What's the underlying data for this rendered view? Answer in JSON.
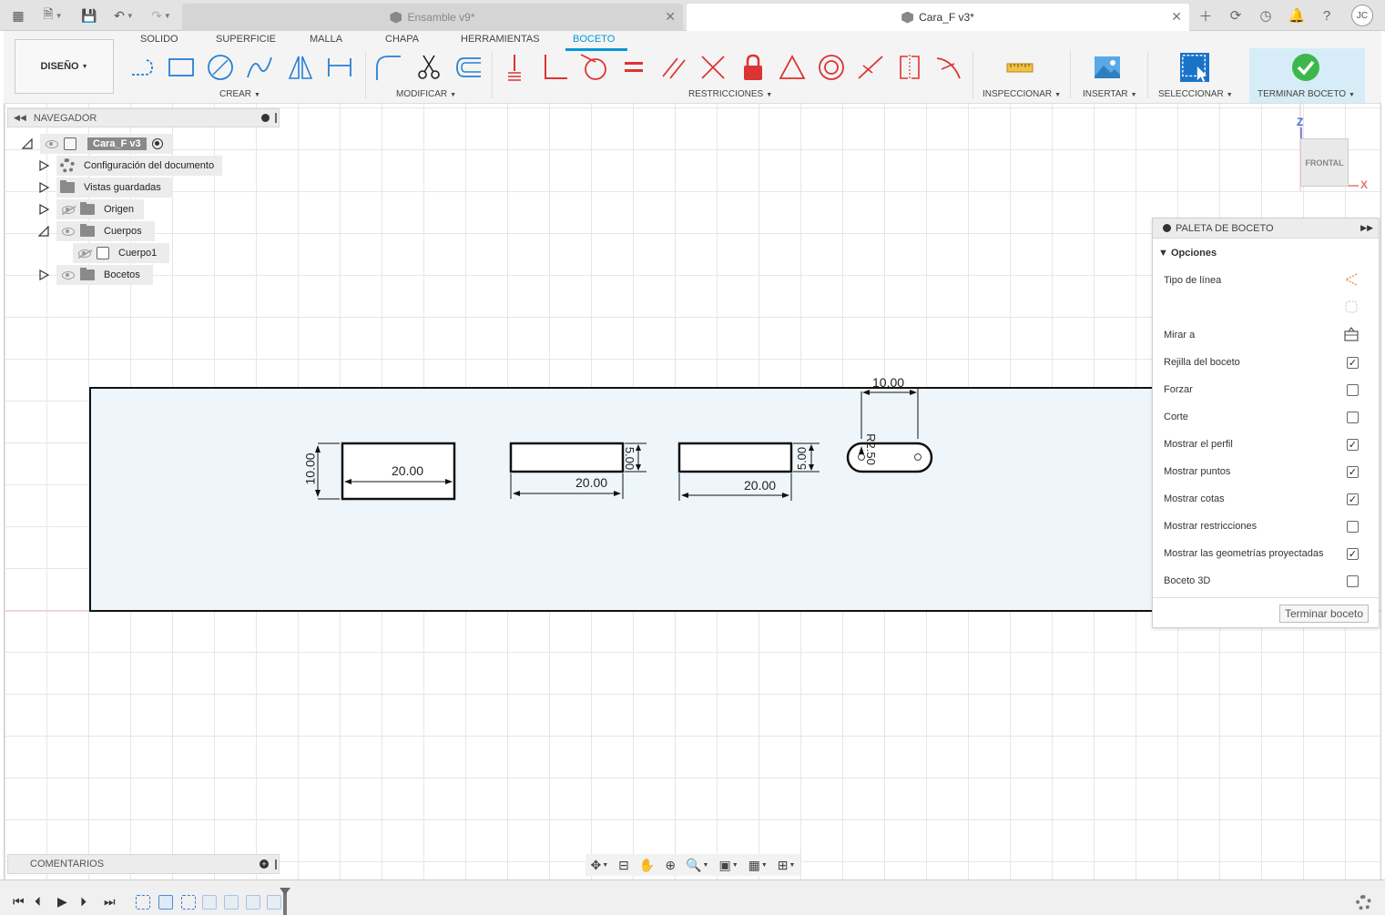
{
  "tabs": [
    {
      "label": "Ensamble v9*",
      "active": false
    },
    {
      "label": "Cara_F v3*",
      "active": true
    }
  ],
  "user_initials": "JC",
  "ribbon": {
    "workspace_label": "DISEÑO",
    "tabs": [
      "SOLIDO",
      "SUPERFICIE",
      "MALLA",
      "CHAPA",
      "HERRAMIENTAS",
      "BOCETO"
    ],
    "active_tab": "BOCETO",
    "groups": {
      "create": "CREAR",
      "modify": "MODIFICAR",
      "constraints": "RESTRICCIONES",
      "inspect": "INSPECCIONAR",
      "insert": "INSERTAR",
      "select": "SELECCIONAR",
      "finish": "TERMINAR BOCETO"
    },
    "accent_color": "#0696d7"
  },
  "navigator": {
    "title": "NAVEGADOR",
    "root": "Cara_F v3",
    "items": [
      {
        "label": "Configuración del documento"
      },
      {
        "label": "Vistas guardadas"
      },
      {
        "label": "Origen"
      },
      {
        "label": "Cuerpos"
      },
      {
        "label": "Cuerpo1"
      },
      {
        "label": "Bocetos"
      }
    ]
  },
  "viewcube": {
    "face": "FRONTAL",
    "z_axis": "Z",
    "x_axis": "X"
  },
  "sketch": {
    "dims": {
      "rect1_width": "20.00",
      "rect1_height": "10.00",
      "rect2_width": "20.00",
      "rect2_height": "5.00",
      "rect3_width": "20.00",
      "rect3_height": "5.00",
      "slot_length": "10.00",
      "slot_radius": "R2.50"
    }
  },
  "palette": {
    "title": "PALETA DE BOCETO",
    "section": "Opciones",
    "rows": [
      {
        "label": "Tipo de línea",
        "control": "icon"
      },
      {
        "label": "Mirar a",
        "control": "icon"
      },
      {
        "label": "Rejilla del boceto",
        "checked": true
      },
      {
        "label": "Forzar",
        "checked": false
      },
      {
        "label": "Corte",
        "checked": false
      },
      {
        "label": "Mostrar el perfil",
        "checked": true
      },
      {
        "label": "Mostrar puntos",
        "checked": true
      },
      {
        "label": "Mostrar cotas",
        "checked": true
      },
      {
        "label": "Mostrar restricciones",
        "checked": false
      },
      {
        "label": "Mostrar las geometrías proyectadas",
        "checked": true
      },
      {
        "label": "Boceto 3D",
        "checked": false
      }
    ],
    "finish_button": "Terminar boceto"
  },
  "comments": {
    "title": "COMENTARIOS"
  }
}
